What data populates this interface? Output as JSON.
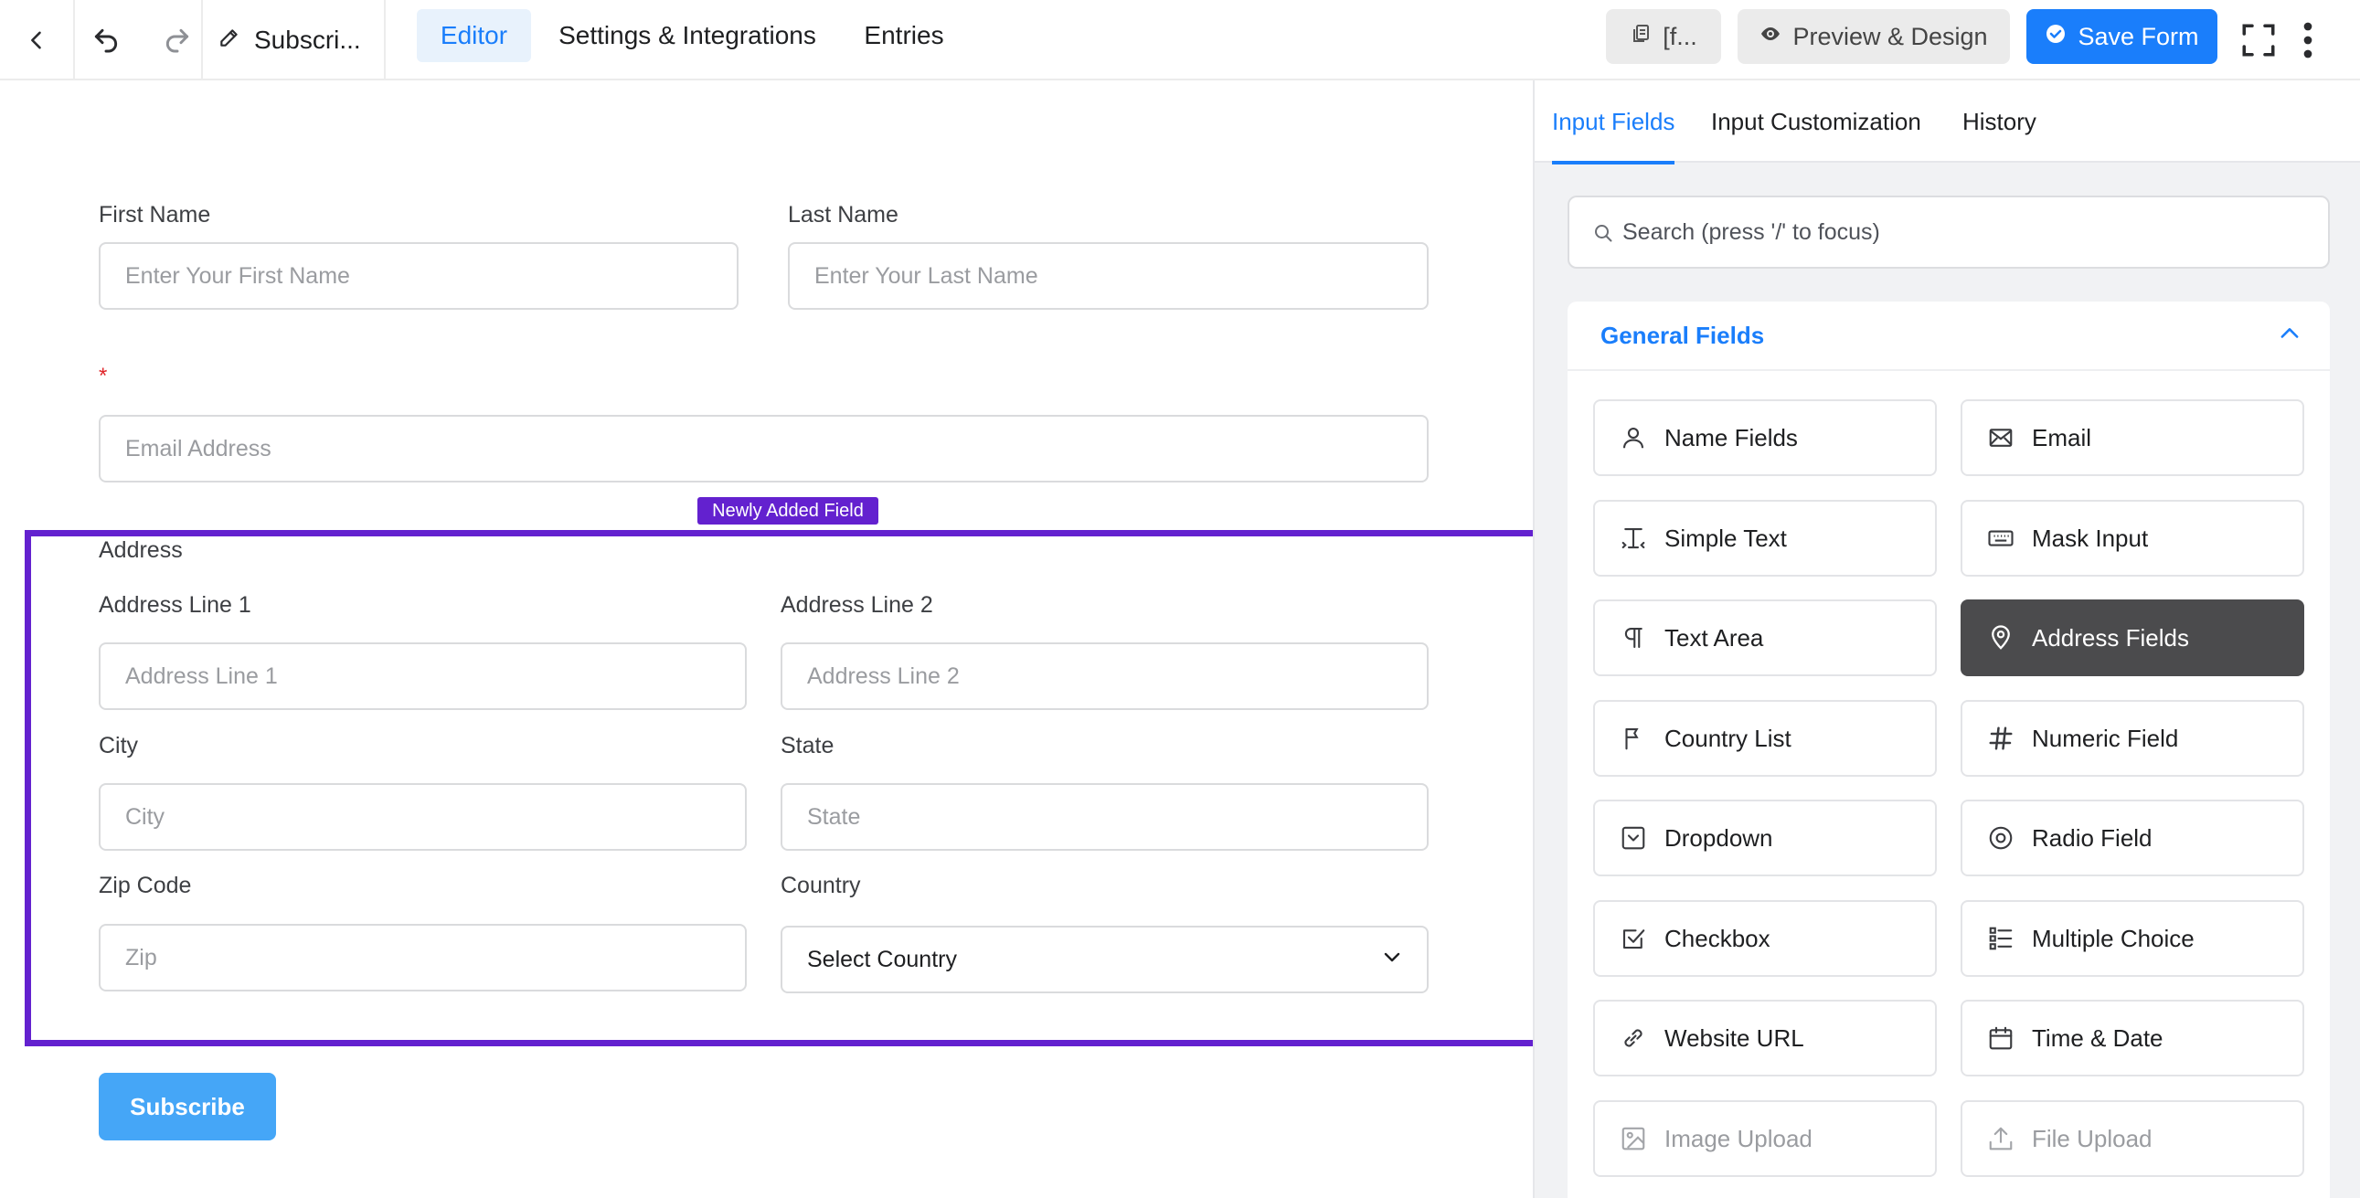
{
  "topbar": {
    "form_title": "Subscri...",
    "tabs": [
      {
        "label": "Editor"
      },
      {
        "label": "Settings & Integrations"
      },
      {
        "label": "Entries"
      }
    ],
    "shortcode_label": "[f...",
    "preview_label": "Preview & Design",
    "save_label": "Save Form"
  },
  "form": {
    "first_name_label": "First Name",
    "first_name_placeholder": "Enter Your First Name",
    "last_name_label": "Last Name",
    "last_name_placeholder": "Enter Your Last Name",
    "required_mark": "*",
    "email_placeholder": "Email Address",
    "new_badge": "Newly Added Field",
    "address_label": "Address",
    "address_line1_label": "Address Line 1",
    "address_line1_placeholder": "Address Line 1",
    "address_line2_label": "Address Line 2",
    "address_line2_placeholder": "Address Line 2",
    "city_label": "City",
    "city_placeholder": "City",
    "state_label": "State",
    "state_placeholder": "State",
    "zip_label": "Zip Code",
    "zip_placeholder": "Zip",
    "country_label": "Country",
    "country_value": "Select Country",
    "submit_label": "Subscribe"
  },
  "sidebar": {
    "tabs": [
      {
        "label": "Input Fields"
      },
      {
        "label": "Input Customization"
      },
      {
        "label": "History"
      }
    ],
    "search_placeholder": "Search (press '/' to focus)",
    "panel_title": "General Fields",
    "fields": [
      {
        "label": "Name Fields",
        "icon": "user-icon"
      },
      {
        "label": "Email",
        "icon": "envelope-icon"
      },
      {
        "label": "Simple Text",
        "icon": "text-cursor-icon"
      },
      {
        "label": "Mask Input",
        "icon": "keyboard-icon"
      },
      {
        "label": "Text Area",
        "icon": "paragraph-icon"
      },
      {
        "label": "Address Fields",
        "icon": "map-pin-icon"
      },
      {
        "label": "Country List",
        "icon": "flag-icon"
      },
      {
        "label": "Numeric Field",
        "icon": "hash-icon"
      },
      {
        "label": "Dropdown",
        "icon": "dropdown-icon"
      },
      {
        "label": "Radio Field",
        "icon": "radio-icon"
      },
      {
        "label": "Checkbox",
        "icon": "checkbox-icon"
      },
      {
        "label": "Multiple Choice",
        "icon": "list-icon"
      },
      {
        "label": "Website URL",
        "icon": "link-icon"
      },
      {
        "label": "Time & Date",
        "icon": "calendar-icon"
      },
      {
        "label": "Image Upload",
        "icon": "image-icon"
      },
      {
        "label": "File Upload",
        "icon": "upload-icon"
      }
    ]
  },
  "colors": {
    "accent": "#1a7efb",
    "highlight": "#6321cf",
    "submit": "#45a6f7",
    "selected_field": "#4b4b4d",
    "required": "#e0262a"
  }
}
